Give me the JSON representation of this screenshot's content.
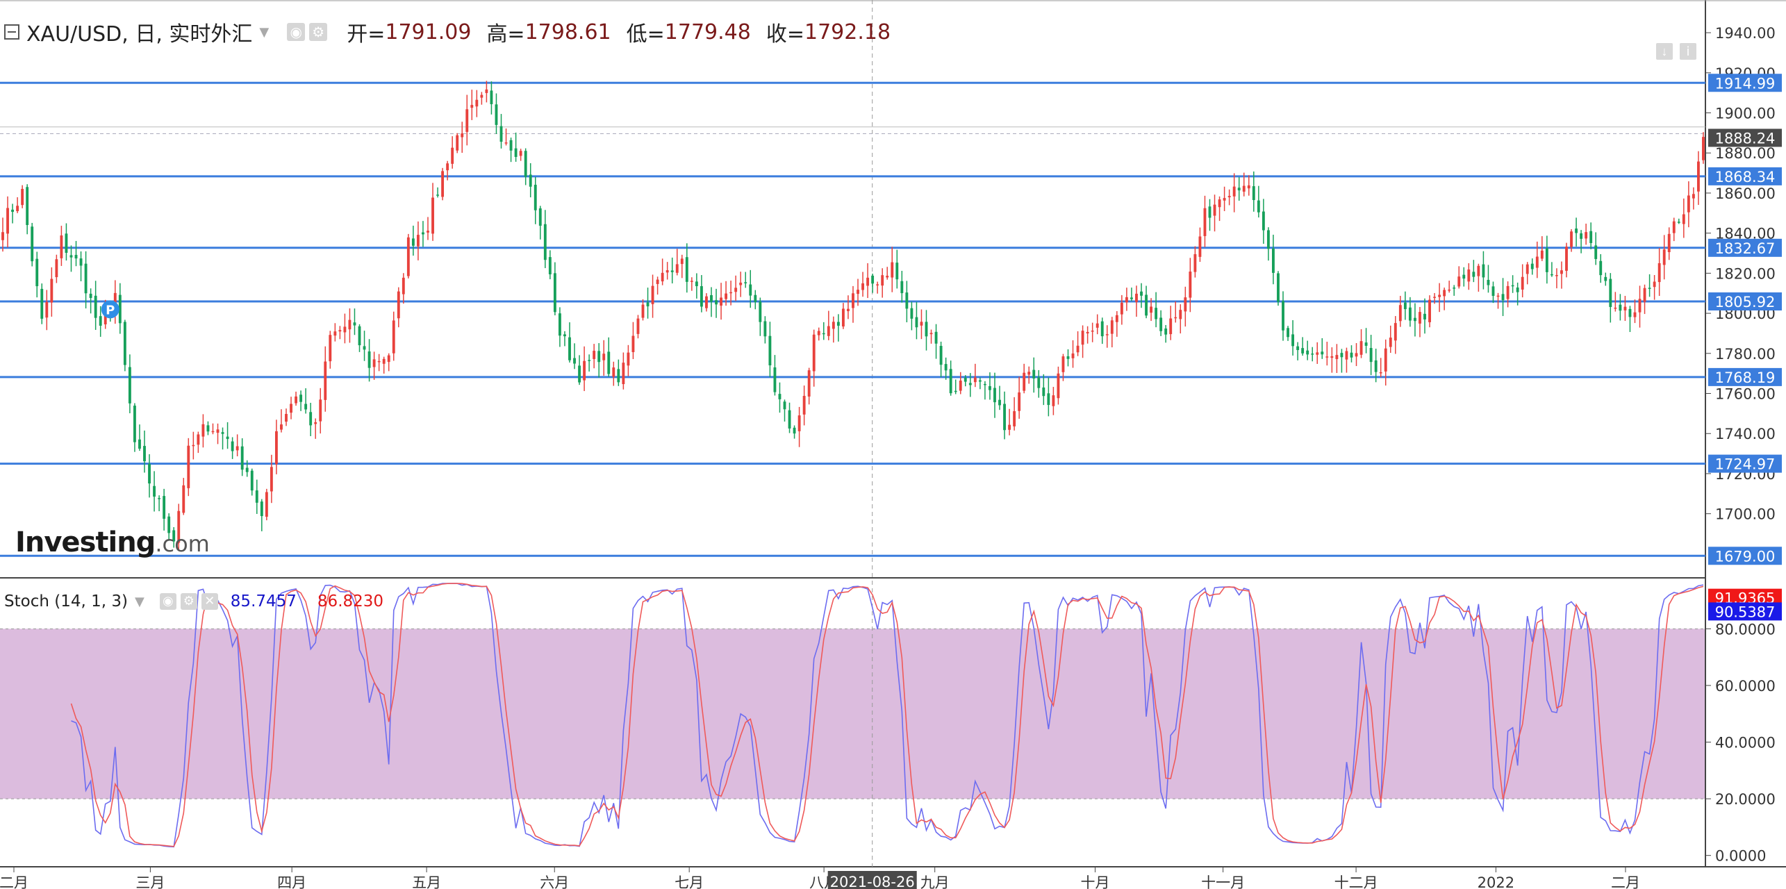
{
  "header": {
    "symbol": "XAU/USD, 日, 实时外汇",
    "open_label": "开=",
    "open": "1791.09",
    "high_label": "高=",
    "high": "1798.61",
    "low_label": "低=",
    "low": "1779.48",
    "close_label": "收=",
    "close": "1792.18"
  },
  "stoch_header": {
    "name": "Stoch (14, 1, 3)",
    "k": "85.7457",
    "d": "86.8230"
  },
  "logo": {
    "main": "Investing",
    "suffix": ".com"
  },
  "marker": "P",
  "colors": {
    "up": "#e8413c",
    "down": "#16a05a",
    "hline": "#3b7ddd",
    "stoch_band": "#dcbcde",
    "k_line": "#6c6cf0",
    "d_line": "#ef5a5a",
    "last_price": "#4a4a4a",
    "k_badge": "#1a1ae8",
    "d_badge": "#f01818"
  },
  "chart_data": [
    {
      "type": "candlestick",
      "symbol": "XAU/USD",
      "ylim": [
        1668,
        1948
      ],
      "y_ticks": [
        "1940.00",
        "1920.00",
        "1900.00",
        "1880.00",
        "1860.00",
        "1840.00",
        "1820.00",
        "1800.00",
        "1780.00",
        "1760.00",
        "1740.00",
        "1720.00",
        "1700.00"
      ],
      "x_ticks": [
        {
          "label": "二月",
          "pos": 0.0
        },
        {
          "label": "三月",
          "pos": 0.08
        },
        {
          "label": "四月",
          "pos": 0.163
        },
        {
          "label": "五月",
          "pos": 0.242
        },
        {
          "label": "六月",
          "pos": 0.317
        },
        {
          "label": "七月",
          "pos": 0.396
        },
        {
          "label": "八月",
          "pos": 0.475
        },
        {
          "label": "九月",
          "pos": 0.54
        },
        {
          "label": "十月",
          "pos": 0.634
        },
        {
          "label": "十一月",
          "pos": 0.709
        },
        {
          "label": "十二月",
          "pos": 0.787
        },
        {
          "label": "2022",
          "pos": 0.869
        },
        {
          "label": "二月",
          "pos": 0.945
        }
      ],
      "crosshair_date": "2021-08-26",
      "levels": [
        "1914.99",
        "1868.34",
        "1832.67",
        "1805.92",
        "1768.19",
        "1724.97",
        "1679.00"
      ],
      "last_price": "1888.24",
      "anchors": [
        [
          0,
          1845
        ],
        [
          4,
          1860
        ],
        [
          8,
          1795
        ],
        [
          12,
          1836
        ],
        [
          16,
          1822
        ],
        [
          20,
          1790
        ],
        [
          23,
          1810
        ],
        [
          27,
          1735
        ],
        [
          31,
          1710
        ],
        [
          35,
          1688
        ],
        [
          38,
          1730
        ],
        [
          42,
          1745
        ],
        [
          46,
          1738
        ],
        [
          50,
          1722
        ],
        [
          53,
          1695
        ],
        [
          56,
          1742
        ],
        [
          60,
          1760
        ],
        [
          64,
          1742
        ],
        [
          67,
          1788
        ],
        [
          71,
          1795
        ],
        [
          75,
          1775
        ],
        [
          79,
          1780
        ],
        [
          83,
          1835
        ],
        [
          87,
          1845
        ],
        [
          91,
          1878
        ],
        [
          95,
          1898
        ],
        [
          99,
          1908
        ],
        [
          102,
          1890
        ],
        [
          106,
          1880
        ],
        [
          110,
          1842
        ],
        [
          114,
          1790
        ],
        [
          118,
          1770
        ],
        [
          122,
          1780
        ],
        [
          126,
          1765
        ],
        [
          130,
          1800
        ],
        [
          134,
          1815
        ],
        [
          138,
          1828
        ],
        [
          142,
          1810
        ],
        [
          146,
          1800
        ],
        [
          150,
          1815
        ],
        [
          154,
          1808
        ],
        [
          158,
          1762
        ],
        [
          162,
          1738
        ],
        [
          166,
          1785
        ],
        [
          170,
          1792
        ],
        [
          174,
          1810
        ],
        [
          178,
          1815
        ],
        [
          182,
          1824
        ],
        [
          186,
          1795
        ],
        [
          190,
          1792
        ],
        [
          194,
          1762
        ],
        [
          198,
          1768
        ],
        [
          202,
          1758
        ],
        [
          206,
          1742
        ],
        [
          210,
          1775
        ],
        [
          214,
          1758
        ],
        [
          218,
          1780
        ],
        [
          222,
          1793
        ],
        [
          226,
          1788
        ],
        [
          230,
          1812
        ],
        [
          234,
          1802
        ],
        [
          238,
          1792
        ],
        [
          242,
          1810
        ],
        [
          246,
          1848
        ],
        [
          250,
          1862
        ],
        [
          254,
          1866
        ],
        [
          258,
          1842
        ],
        [
          262,
          1790
        ],
        [
          266,
          1780
        ],
        [
          270,
          1778
        ],
        [
          274,
          1775
        ],
        [
          278,
          1782
        ],
        [
          282,
          1772
        ],
        [
          286,
          1800
        ],
        [
          290,
          1798
        ],
        [
          294,
          1808
        ],
        [
          298,
          1815
        ],
        [
          302,
          1822
        ],
        [
          306,
          1808
        ],
        [
          310,
          1812
        ],
        [
          314,
          1830
        ],
        [
          318,
          1820
        ],
        [
          322,
          1843
        ],
        [
          326,
          1830
        ],
        [
          330,
          1800
        ],
        [
          334,
          1802
        ],
        [
          338,
          1815
        ],
        [
          342,
          1845
        ],
        [
          346,
          1862
        ],
        [
          348,
          1888
        ]
      ],
      "candle_count": 349
    },
    {
      "type": "line",
      "name": "Stoch (14, 1, 3)",
      "ylim": [
        -4,
        97
      ],
      "band": [
        20,
        80
      ],
      "y_ticks": [
        "80.0000",
        "60.0000",
        "40.0000",
        "20.0000",
        "0.0000"
      ],
      "series": [
        {
          "name": "%K",
          "last": "90.5387"
        },
        {
          "name": "%D",
          "last": "91.9365"
        }
      ]
    }
  ]
}
